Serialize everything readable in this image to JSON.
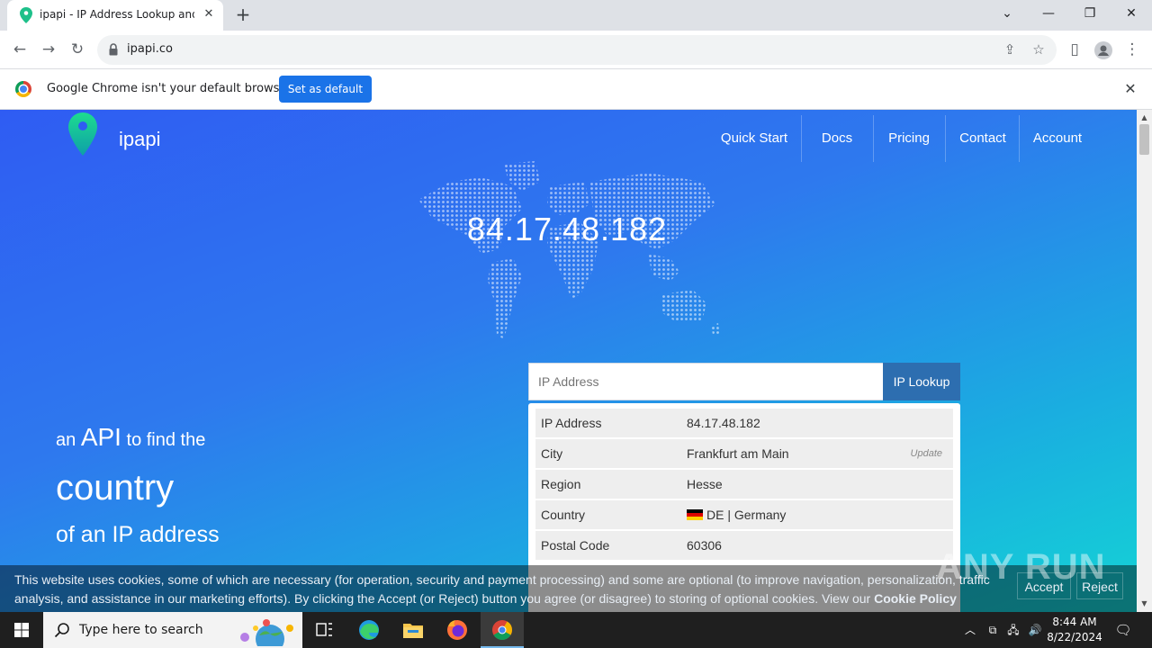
{
  "browser": {
    "tab_title": "ipapi - IP Address Lookup and G",
    "url": "ipapi.co",
    "infobar_text": "Google Chrome isn't your default browser",
    "infobar_button": "Set as default"
  },
  "site": {
    "brand": "ipapi",
    "nav": [
      "Quick Start",
      "Docs",
      "Pricing",
      "Contact",
      "Account"
    ],
    "hero_ip": "84.17.48.182",
    "tagline": {
      "prefix": "an",
      "api": "API",
      "suffix": "to find the",
      "word": "country",
      "line3": "of an IP address"
    },
    "input_placeholder": "IP Address",
    "lookup_button": "IP Lookup",
    "results": [
      {
        "key": "IP Address",
        "value": "84.17.48.182"
      },
      {
        "key": "City",
        "value": "Frankfurt am Main",
        "action": "Update"
      },
      {
        "key": "Region",
        "value": "Hesse"
      },
      {
        "key": "Country",
        "value": "DE | Germany"
      },
      {
        "key": "Postal Code",
        "value": "60306"
      }
    ]
  },
  "cookie": {
    "text": "This website uses cookies, some of which are necessary (for operation, security and payment processing) and some are optional (to improve navigation, personalization, traffic analysis, and assistance in our marketing efforts). By clicking the Accept (or Reject) button you agree (or disagree) to storing of optional cookies. View our",
    "link": "Cookie Policy",
    "accept": "Accept",
    "reject": "Reject"
  },
  "watermark": "ANY RUN",
  "taskbar": {
    "search_placeholder": "Type here to search",
    "time": "8:44 AM",
    "date": "8/22/2024"
  },
  "colors": {
    "brand_pin_top": "#1ddc8f",
    "brand_pin_bottom": "#0e9fa8",
    "chrome_blue": "#1a73e8",
    "lookup_btn": "#2d6eb0"
  }
}
